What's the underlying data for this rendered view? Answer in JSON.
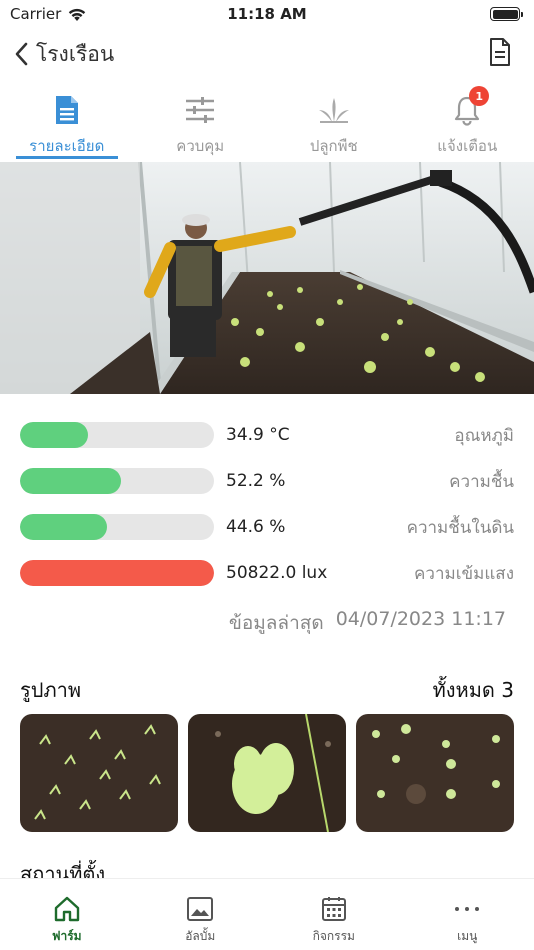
{
  "status_bar": {
    "carrier": "Carrier",
    "time": "11:18 AM"
  },
  "nav": {
    "title": "โรงเรือน",
    "back_icon": "chevron-left-icon",
    "action_icon": "document-icon"
  },
  "tabs": [
    {
      "label": "รายละเอียด",
      "icon": "document-icon",
      "active": true
    },
    {
      "label": "ควบคุม",
      "icon": "sliders-icon",
      "active": false
    },
    {
      "label": "ปลูกพืช",
      "icon": "plant-icon",
      "active": false
    },
    {
      "label": "แจ้งเตือน",
      "icon": "bell-icon",
      "active": false,
      "badge": "1"
    }
  ],
  "sensors": [
    {
      "value": "34.9 °C",
      "label": "อุณหภูมิ",
      "fill_pct": 35,
      "color": "#5fd07e"
    },
    {
      "value": "52.2 %",
      "label": "ความชื้น",
      "fill_pct": 52,
      "color": "#5fd07e"
    },
    {
      "value": "44.6 %",
      "label": "ความชื้นในดิน",
      "fill_pct": 45,
      "color": "#5fd07e"
    },
    {
      "value": "50822.0 lux",
      "label": "ความเข้มแสง",
      "fill_pct": 100,
      "color": "#f45a4a"
    }
  ],
  "updated": {
    "label": "ข้อมูลล่าสุด",
    "timestamp": "04/07/2023 11:17"
  },
  "photos": {
    "title": "รูปภาพ",
    "count_label": "ทั้งหมด 3"
  },
  "partial_heading": "สถานที่ตั้ง",
  "bottom_nav": [
    {
      "label": "ฟาร์ม",
      "icon": "home-icon",
      "active": true
    },
    {
      "label": "อัลบั้ม",
      "icon": "image-icon",
      "active": false
    },
    {
      "label": "กิจกรรม",
      "icon": "calendar-icon",
      "active": false
    },
    {
      "label": "เมนู",
      "icon": "more-icon",
      "active": false
    }
  ],
  "colors": {
    "accent": "#3a8fd6",
    "active_green": "#1e6b2c",
    "bar_green": "#5fd07e",
    "bar_red": "#f45a4a",
    "badge": "#ee4435"
  }
}
